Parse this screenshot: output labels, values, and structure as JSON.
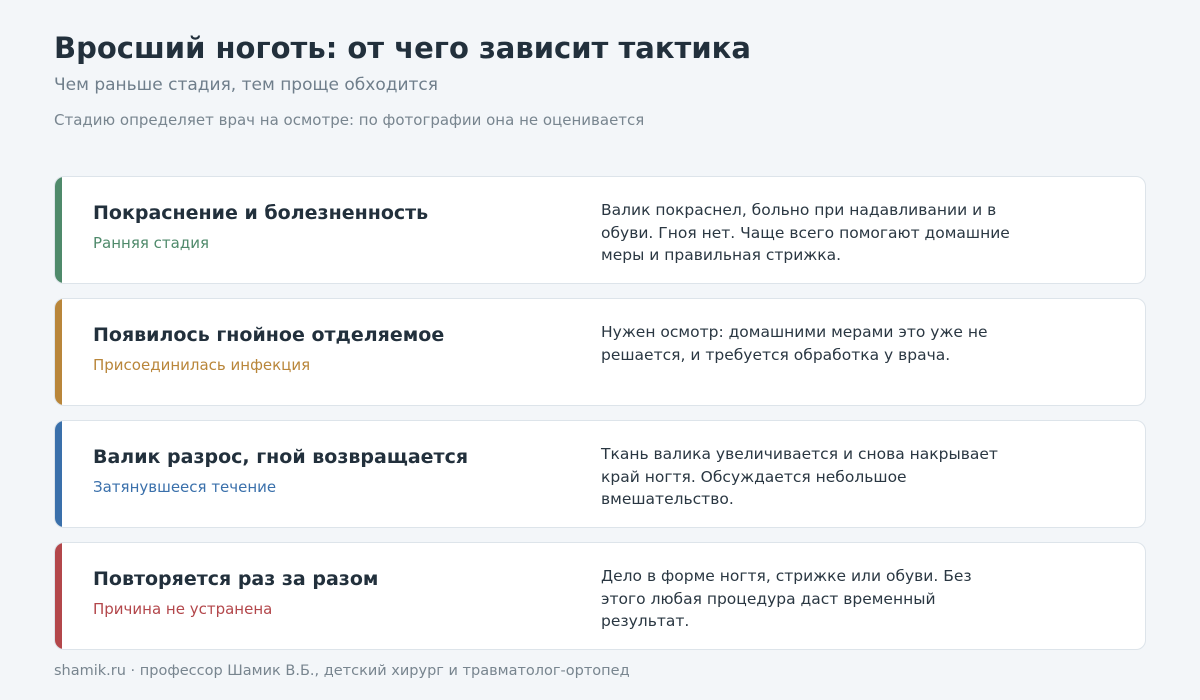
{
  "header": {
    "title": "Вросший ноготь: от чего зависит тактика",
    "subtitle": "Чем раньше стадия, тем проще обходится",
    "note": "Стадию определяет врач на осмотре: по фотографии она не оценивается"
  },
  "colors": {
    "stage1": "#4f8a6b",
    "stage2": "#b9863a",
    "stage3": "#3a70ab",
    "stage4": "#b3474b"
  },
  "cards": [
    {
      "heading": "Покраснение и болезненность",
      "stage": "Ранняя стадия",
      "description": "Валик покраснел, больно при надавливании и в обуви. Гноя нет. Чаще всего помогают домашние меры и правильная стрижка."
    },
    {
      "heading": "Появилось гнойное отделяемое",
      "stage": "Присоединилась инфекция",
      "description": "Нужен осмотр: домашними мерами это уже не решается, и требуется обработка у врача."
    },
    {
      "heading": "Валик разрос, гной возвращается",
      "stage": "Затянувшееся течение",
      "description": "Ткань валика увеличивается и снова накрывает край ногтя. Обсуждается небольшое вмешательство."
    },
    {
      "heading": "Повторяется раз за разом",
      "stage": "Причина не устранена",
      "description": "Дело в форме ногтя, стрижке или обуви. Без этого любая процедура даст временный результат."
    }
  ],
  "footer": {
    "text": "shamik.ru · профессор Шамик В.Б., детский хирург и травматолог-ортопед"
  }
}
